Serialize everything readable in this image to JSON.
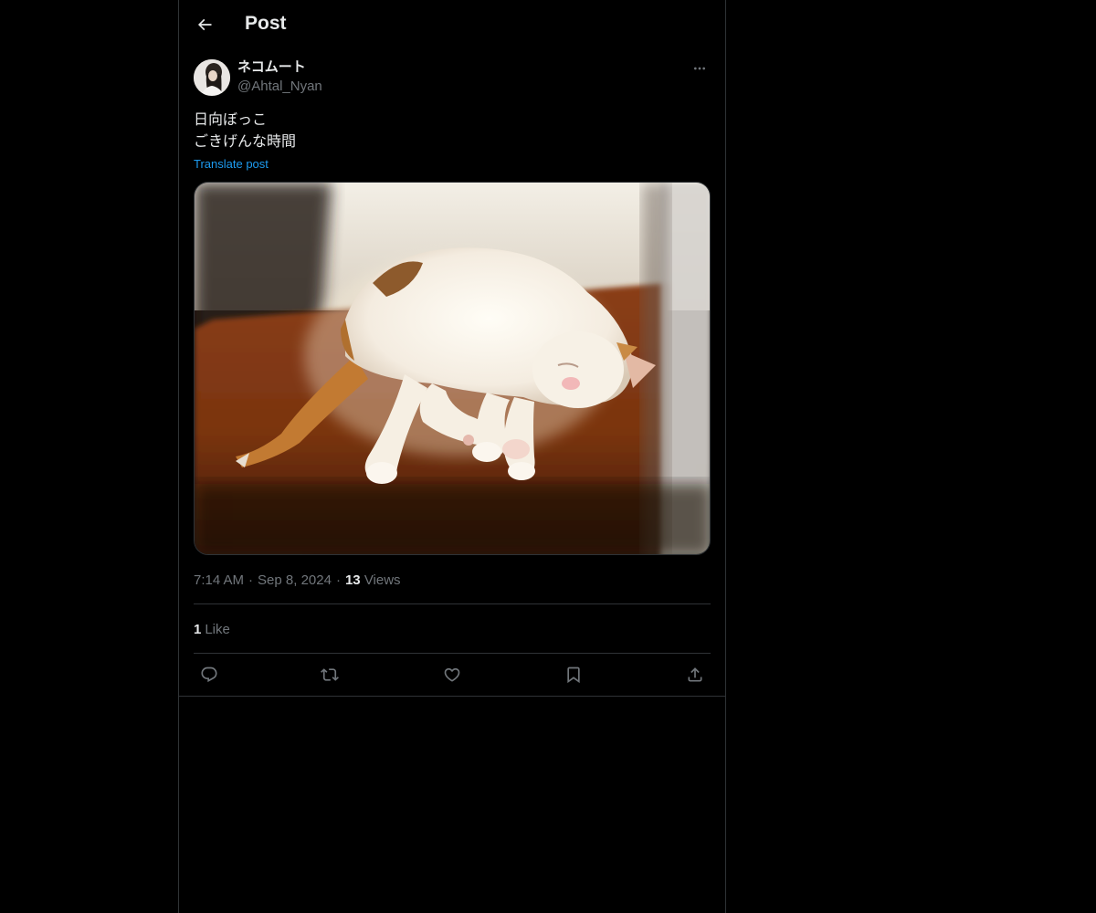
{
  "header": {
    "title": "Post",
    "back_icon": "arrow-left-icon"
  },
  "author": {
    "display_name": "ネコムート",
    "handle": "@Ahtal_Nyan",
    "more_icon": "more-horizontal-icon"
  },
  "post": {
    "lines": [
      "日向ぼっこ",
      "ごきげんな時間"
    ],
    "translate_label": "Translate post",
    "media": "photo of a white and calico cat sleeping in the sun on a wooden floor"
  },
  "meta": {
    "time": "7:14 AM",
    "date": "Sep 8, 2024",
    "views_count": "13",
    "views_label": "Views"
  },
  "engagement": {
    "likes_count": "1",
    "likes_label": "Like"
  },
  "actions": [
    {
      "name": "reply",
      "icon": "reply-icon"
    },
    {
      "name": "repost",
      "icon": "repost-icon"
    },
    {
      "name": "like",
      "icon": "heart-icon"
    },
    {
      "name": "bookmark",
      "icon": "bookmark-icon"
    },
    {
      "name": "share",
      "icon": "share-icon"
    }
  ],
  "colors": {
    "background": "#000000",
    "text_primary": "#e7e9ea",
    "text_secondary": "#71767b",
    "link": "#1d9bf0",
    "border": "#2f3336"
  }
}
